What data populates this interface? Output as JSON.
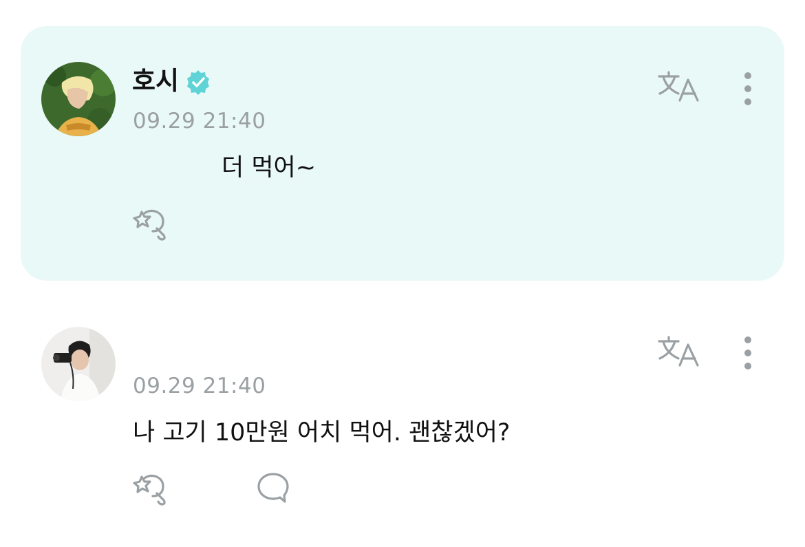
{
  "comments": [
    {
      "author": "호시",
      "verified": true,
      "timestamp": "09.29 21:40",
      "text": "더 먹어~",
      "highlighted": true,
      "background_color": "#e9f9f7",
      "actions": [
        "translate-icon",
        "more-options-icon",
        "like-icon"
      ]
    },
    {
      "author": "",
      "verified": false,
      "timestamp": "09.29 21:40",
      "text": "나 고기 10만원 어치 먹어. 괜찮겠어?",
      "highlighted": false,
      "actions": [
        "translate-icon",
        "more-options-icon",
        "like-icon",
        "reply-icon"
      ]
    }
  ],
  "colors": {
    "verified_badge": "#5fd3d6",
    "icon_gray": "#9aa0a3",
    "timestamp_gray": "#9aa0a3"
  }
}
